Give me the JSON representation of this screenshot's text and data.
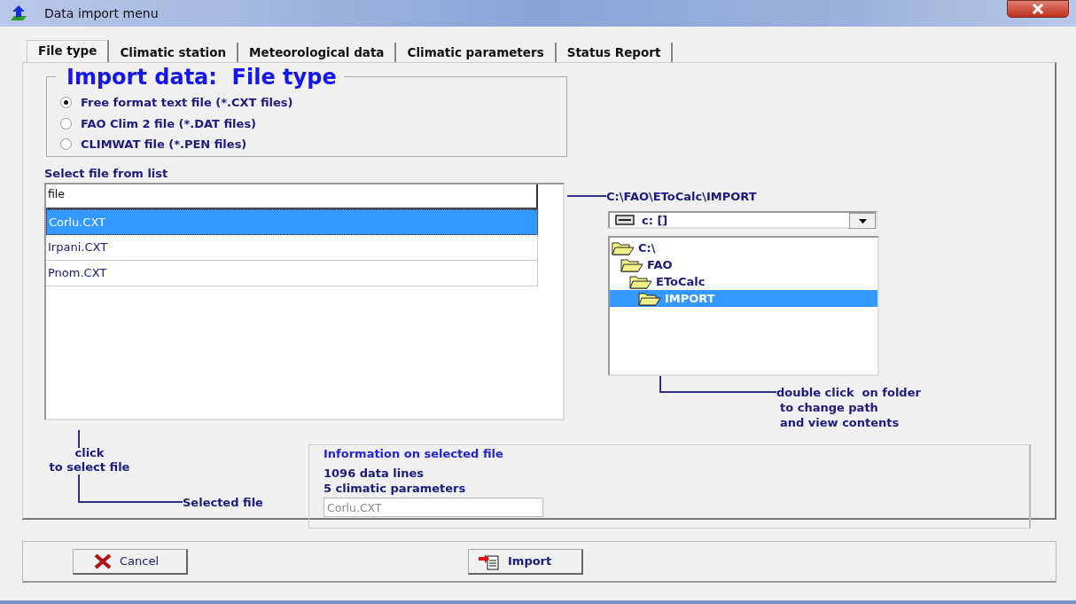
{
  "window": {
    "title": "Data import menu"
  },
  "tabs": [
    {
      "label": "File type",
      "selected": true
    },
    {
      "label": "Climatic station",
      "selected": false
    },
    {
      "label": "Meteorological data",
      "selected": false
    },
    {
      "label": "Climatic parameters",
      "selected": false
    },
    {
      "label": "Status Report",
      "selected": false
    }
  ],
  "file_type": {
    "heading": "Import data:  File type",
    "options": [
      {
        "label": "Free format text file (*.CXT files)",
        "selected": true
      },
      {
        "label": "FAO Clim 2 file (*.DAT files)",
        "selected": false
      },
      {
        "label": "CLIMWAT file (*.PEN files)",
        "selected": false
      }
    ]
  },
  "file_list": {
    "label": "Select file from list",
    "column": "file",
    "rows": [
      {
        "name": "Corlu.CXT",
        "selected": true
      },
      {
        "name": "Irpani.CXT",
        "selected": false
      },
      {
        "name": "Pnom.CXT",
        "selected": false
      }
    ]
  },
  "path": "C:\\FAO\\EToCalc\\IMPORT",
  "drive": {
    "value": "c: []"
  },
  "folders": [
    {
      "name": "C:\\",
      "selected": false,
      "children": [
        {
          "name": "FAO",
          "selected": false,
          "children": [
            {
              "name": "EToCalc",
              "selected": false,
              "children": [
                {
                  "name": "IMPORT",
                  "selected": true
                }
              ]
            }
          ]
        }
      ]
    }
  ],
  "folder_hint": [
    "double click  on folder",
    "to change path",
    "and view contents"
  ],
  "select_hint": [
    "click",
    "to select file"
  ],
  "selected_file": {
    "label": "Selected file",
    "value": "Corlu.CXT"
  },
  "info": {
    "heading": "Information on selected file",
    "lines": [
      "1096 data lines",
      "5 climatic parameters"
    ]
  },
  "buttons": [
    {
      "label": "Cancel",
      "kind": "cancel"
    },
    {
      "label": "Import",
      "kind": "import"
    }
  ]
}
